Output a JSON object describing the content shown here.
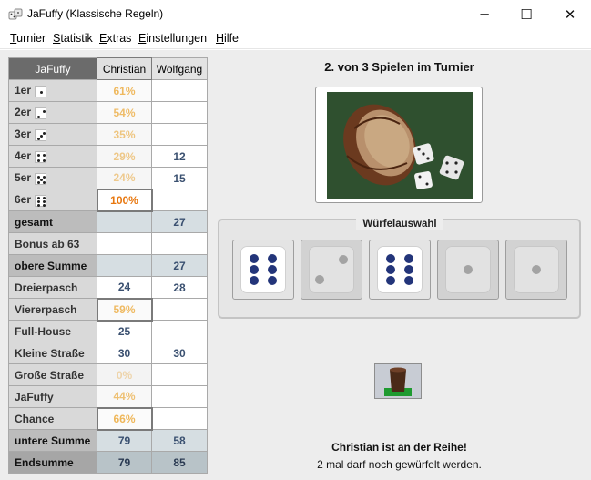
{
  "window": {
    "title": "JaFuffy (Klassische Regeln)",
    "minimize": "─",
    "maximize": "☐",
    "close": "✕"
  },
  "menu": [
    "Turnier",
    "Statistik",
    "Extras",
    "Einstellungen",
    "Hilfe"
  ],
  "table": {
    "headers": [
      "JaFuffy",
      "Christian",
      "Wolfgang"
    ],
    "rows": [
      {
        "label": "1er",
        "christian": "61%",
        "wolfgang": ""
      },
      {
        "label": "2er",
        "christian": "54%",
        "wolfgang": ""
      },
      {
        "label": "3er",
        "christian": "35%",
        "wolfgang": ""
      },
      {
        "label": "4er",
        "christian": "29%",
        "wolfgang": "12"
      },
      {
        "label": "5er",
        "christian": "24%",
        "wolfgang": "15"
      },
      {
        "label": "6er",
        "christian": "100%",
        "wolfgang": ""
      },
      {
        "label": "gesamt",
        "christian": "",
        "wolfgang": "27"
      },
      {
        "label": "Bonus ab 63",
        "christian": "",
        "wolfgang": ""
      },
      {
        "label": "obere Summe",
        "christian": "",
        "wolfgang": "27"
      },
      {
        "label": "Dreierpasch",
        "christian": "24",
        "wolfgang": "28"
      },
      {
        "label": "Viererpasch",
        "christian": "59%",
        "wolfgang": ""
      },
      {
        "label": "Full-House",
        "christian": "25",
        "wolfgang": ""
      },
      {
        "label": "Kleine Straße",
        "christian": "30",
        "wolfgang": "30"
      },
      {
        "label": "Große Straße",
        "christian": "0%",
        "wolfgang": ""
      },
      {
        "label": "JaFuffy",
        "christian": "44%",
        "wolfgang": ""
      },
      {
        "label": "Chance",
        "christian": "66%",
        "wolfgang": ""
      },
      {
        "label": "untere Summe",
        "christian": "79",
        "wolfgang": "58"
      },
      {
        "label": "Endsumme",
        "christian": "79",
        "wolfgang": "85"
      }
    ]
  },
  "game": {
    "title": "2. von 3 Spielen im Turnier",
    "dice_group_label": "Würfelauswahl",
    "dice": [
      {
        "value": 6,
        "selected": false
      },
      {
        "value": 2,
        "selected": true
      },
      {
        "value": 6,
        "selected": false
      },
      {
        "value": 1,
        "selected": true
      },
      {
        "value": 1,
        "selected": true
      }
    ],
    "status": "Christian ist an der Reihe!",
    "status_detail": "2 mal darf noch gewürfelt werden."
  },
  "colors": {
    "suggestion_orange": "#f0a830",
    "best_suggestion": "#e87810",
    "pip_blue": "#23357a"
  },
  "icons": {
    "app": "dice-icon",
    "roll_button": "dice-cup-icon"
  }
}
